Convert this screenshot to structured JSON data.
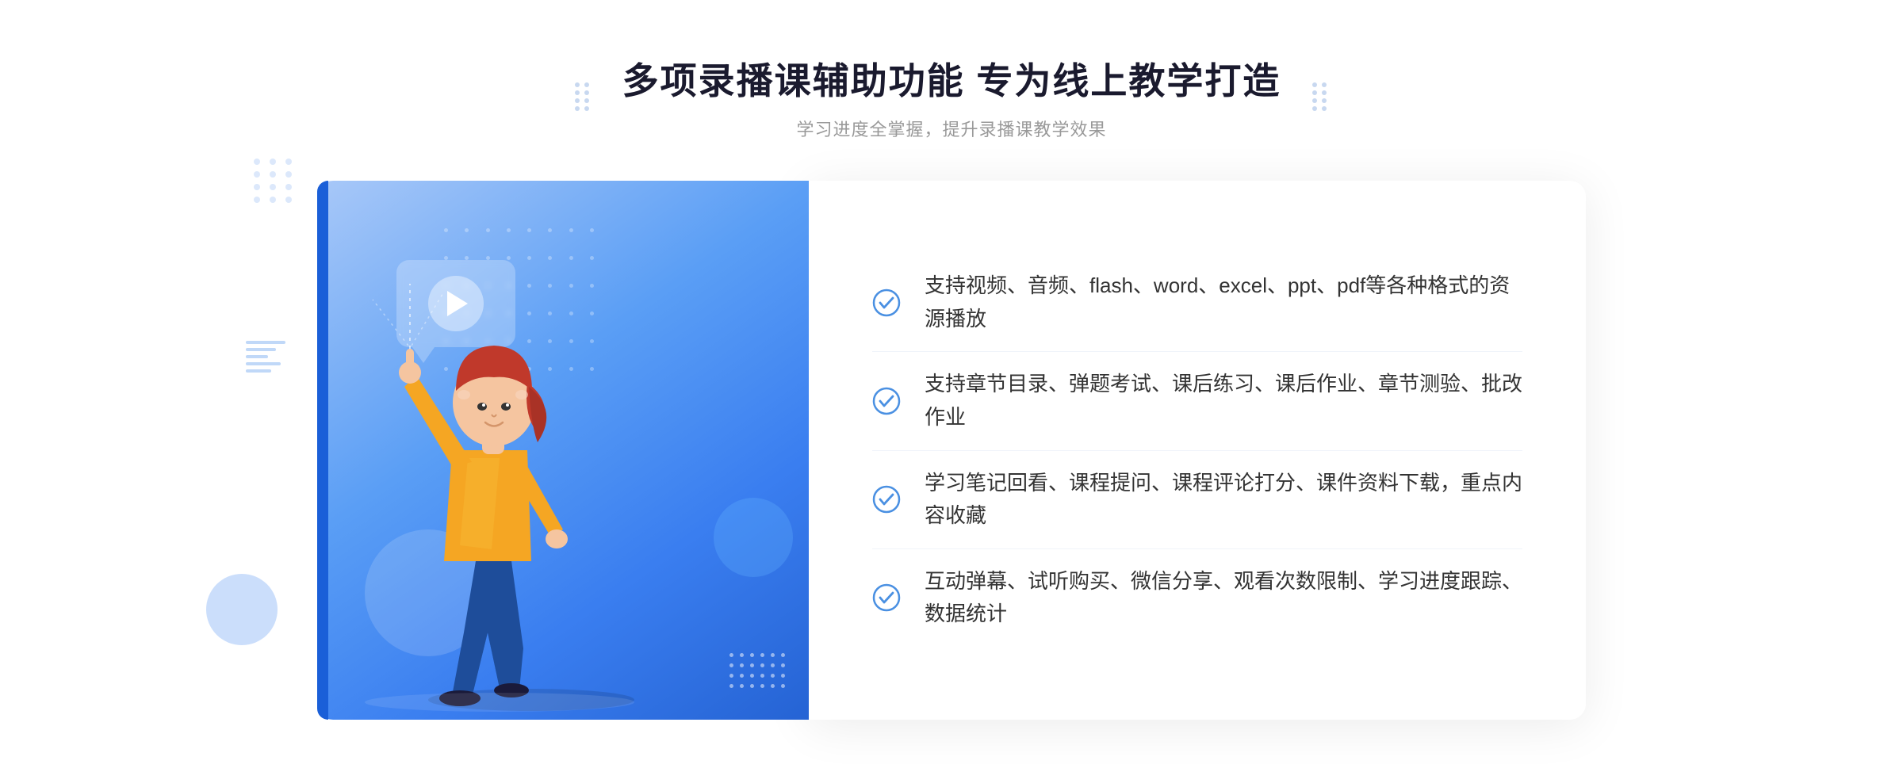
{
  "header": {
    "title": "多项录播课辅助功能 专为线上教学打造",
    "subtitle": "学习进度全掌握，提升录播课教学效果"
  },
  "decoration": {
    "dots_pattern_count": 48,
    "chevrons_symbol": "»"
  },
  "features": [
    {
      "id": 1,
      "text": "支持视频、音频、flash、word、excel、ppt、pdf等各种格式的资源播放"
    },
    {
      "id": 2,
      "text": "支持章节目录、弹题考试、课后练习、课后作业、章节测验、批改作业"
    },
    {
      "id": 3,
      "text": "学习笔记回看、课程提问、课程评论打分、课件资料下载，重点内容收藏"
    },
    {
      "id": 4,
      "text": "互动弹幕、试听购买、微信分享、观看次数限制、学习进度跟踪、数据统计"
    }
  ],
  "colors": {
    "primary_blue": "#3a7ef0",
    "light_blue": "#a8c8f8",
    "check_blue": "#4a90e2",
    "title_color": "#1a1a2e",
    "text_color": "#333333",
    "subtitle_color": "#999999"
  }
}
